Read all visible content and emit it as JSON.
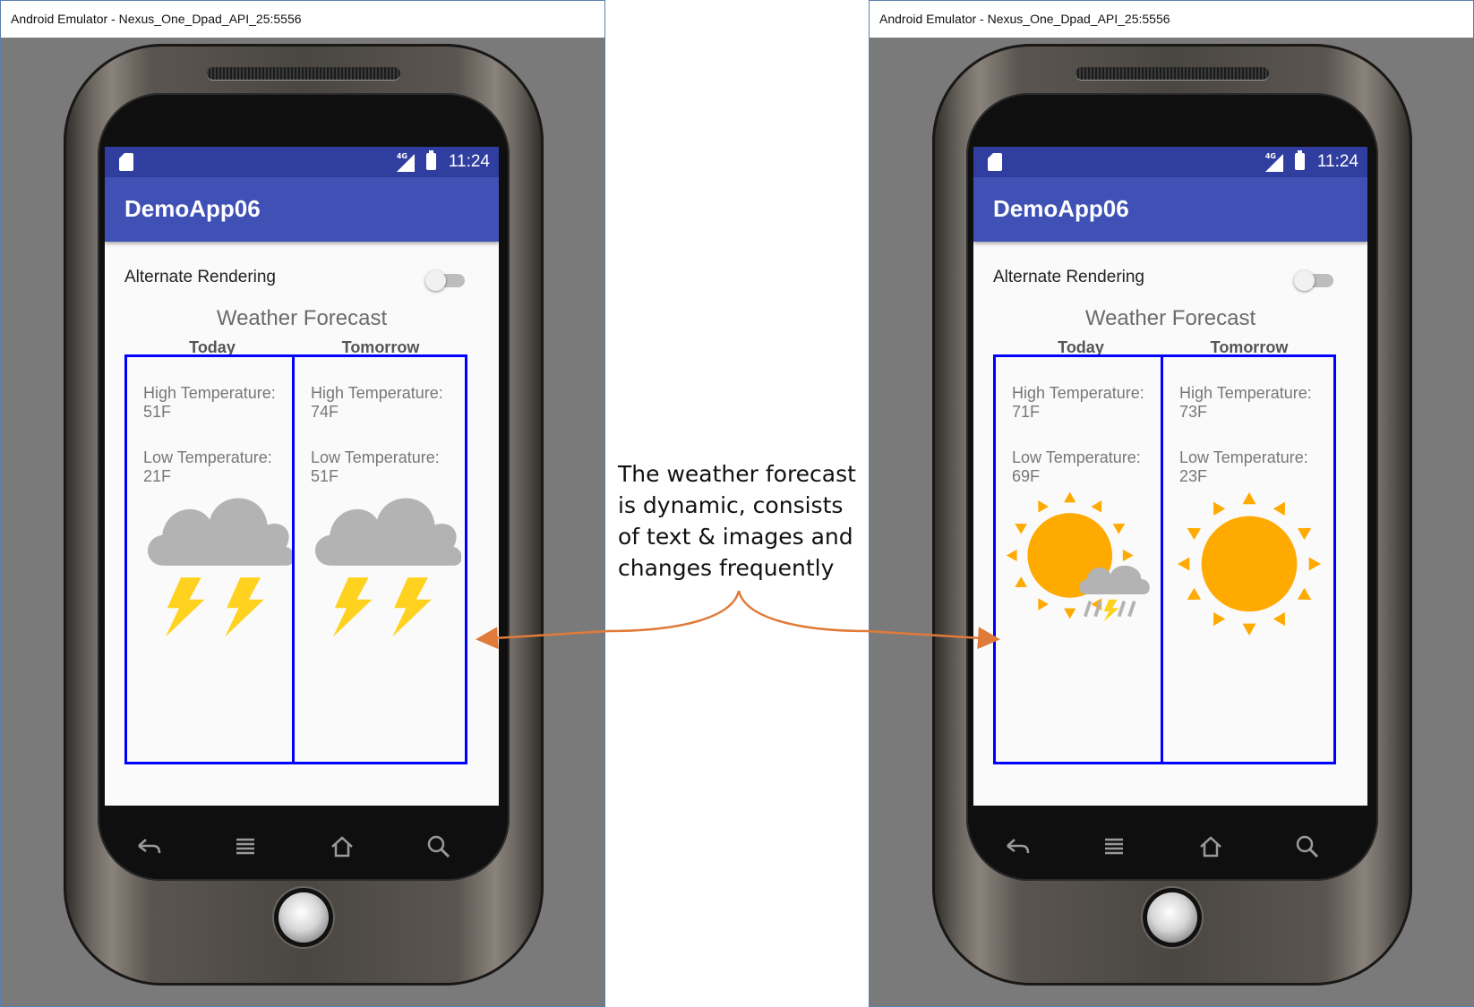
{
  "windows": [
    {
      "title": "Android Emulator - Nexus_One_Dpad_API_25:5556",
      "status_time": "11:24",
      "network_label": "4G",
      "app_title": "DemoApp06",
      "toggle_label": "Alternate Rendering",
      "toggle_on": false,
      "forecast_title": "Weather Forecast",
      "days": [
        {
          "heading": "Today",
          "high_label": "High Temperature:",
          "high_value": "51F",
          "low_label": "Low Temperature:",
          "low_value": "21F",
          "icon": "thunderstorm-icon"
        },
        {
          "heading": "Tomorrow",
          "high_label": "High Temperature:",
          "high_value": "74F",
          "low_label": "Low Temperature:",
          "low_value": "51F",
          "icon": "thunderstorm-icon"
        }
      ]
    },
    {
      "title": "Android Emulator - Nexus_One_Dpad_API_25:5556",
      "status_time": "11:24",
      "network_label": "4G",
      "app_title": "DemoApp06",
      "toggle_label": "Alternate Rendering",
      "toggle_on": false,
      "forecast_title": "Weather Forecast",
      "days": [
        {
          "heading": "Today",
          "high_label": "High Temperature:",
          "high_value": "71F",
          "low_label": "Low Temperature:",
          "low_value": "69F",
          "icon": "sun-with-storm-cloud-icon"
        },
        {
          "heading": "Tomorrow",
          "high_label": "High Temperature:",
          "high_value": "73F",
          "low_label": "Low Temperature:",
          "low_value": "23F",
          "icon": "sun-icon"
        }
      ]
    }
  ],
  "annotation": {
    "lines": [
      "The weather forecast",
      "is dynamic, consists",
      "of text & images and",
      "changes frequently"
    ]
  },
  "colors": {
    "status_bar": "#303f9f",
    "app_bar": "#3f51b5",
    "panel_border": "#0000ff",
    "arrow": "#e07b39",
    "cloud": "#b3b3b3",
    "lightning": "#ffd21f",
    "sun": "#ffaa00"
  },
  "nav_icons": [
    "back-icon",
    "menu-icon",
    "home-icon",
    "search-icon"
  ]
}
